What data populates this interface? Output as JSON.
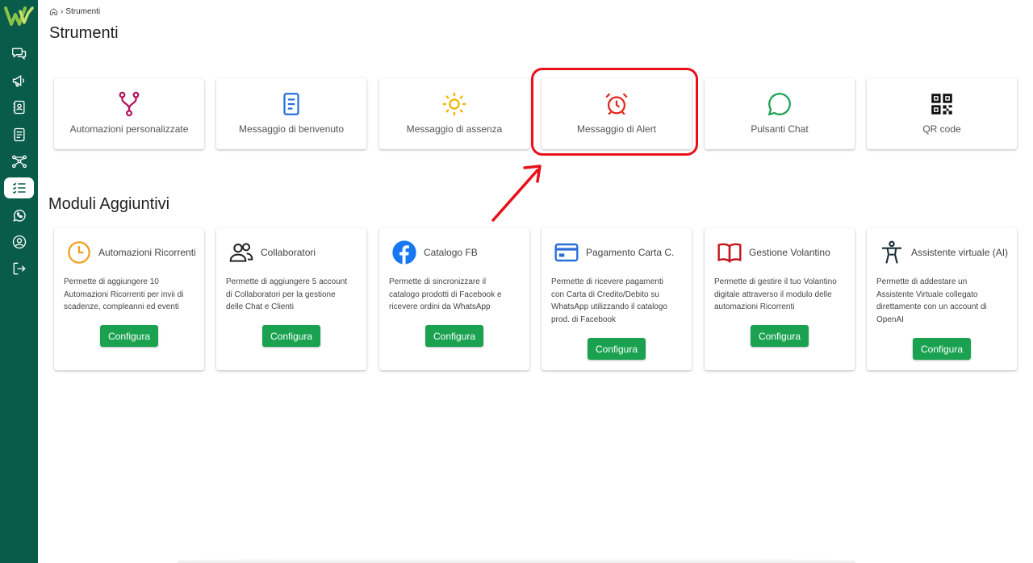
{
  "colors": {
    "sidebar": "#0a5c4a",
    "accent_green": "#1aa251",
    "highlight_red": "#e8111a"
  },
  "breadcrumb": {
    "home_icon": "home-icon",
    "current": "Strumenti"
  },
  "page_title": "Strumenti",
  "sidebar": {
    "items": [
      {
        "icon": "chat-bubbles-icon",
        "active": false
      },
      {
        "icon": "megaphone-icon",
        "active": false
      },
      {
        "icon": "contacts-book-icon",
        "active": false
      },
      {
        "icon": "document-icon",
        "active": false
      },
      {
        "icon": "flow-network-icon",
        "active": false
      },
      {
        "icon": "checklist-icon",
        "active": true
      },
      {
        "icon": "whatsapp-icon",
        "active": false
      },
      {
        "icon": "user-circle-icon",
        "active": false
      },
      {
        "icon": "logout-icon",
        "active": false
      }
    ]
  },
  "tools": [
    {
      "label": "Automazioni personalizzate",
      "icon": "branch-icon",
      "color": "#b5135e"
    },
    {
      "label": "Messaggio di benvenuto",
      "icon": "document-icon",
      "color": "#2a6fd6"
    },
    {
      "label": "Messaggio di assenza",
      "icon": "sun-icon",
      "color": "#f0b400"
    },
    {
      "label": "Messaggio di Alert",
      "icon": "alarm-clock-icon",
      "color": "#e0271d"
    },
    {
      "label": "Pulsanti Chat",
      "icon": "chat-bubble-icon",
      "color": "#1aa251"
    },
    {
      "label": "QR code",
      "icon": "qr-code-icon",
      "color": "#111111"
    }
  ],
  "modules_title": "Moduli Aggiuntivi",
  "modules": [
    {
      "title": "Automazioni Ricorrenti",
      "icon": "clock-icon",
      "color": "#f0a020",
      "desc_lines": [
        "Permette di aggiungere 10",
        "Automazioni Ricorrenti per invii di",
        "scadenze, compleanni ed eventi"
      ],
      "button": "Configura"
    },
    {
      "title": "Collaboratori",
      "icon": "users-icon",
      "color": "#222222",
      "desc_lines": [
        "Permette di aggiungere 5 account",
        "di Collaboratori per la gestione",
        "delle Chat e Clienti"
      ],
      "button": "Configura"
    },
    {
      "title": "Catalogo FB",
      "icon": "facebook-icon",
      "color": "#1877f2",
      "desc_lines": [
        "Permette di sincronizzare il",
        "catalogo prodotti di Facebook e",
        "ricevere ordini da WhatsApp"
      ],
      "button": "Configura"
    },
    {
      "title": "Pagamento Carta C.",
      "icon": "credit-card-icon",
      "color": "#2a6fd6",
      "desc_lines": [
        "Permette di ricevere pagamenti",
        "con Carta di Credito/Debito su",
        "WhatsApp utilizzando il catalogo",
        "prod. di Facebook"
      ],
      "button": "Configura"
    },
    {
      "title": "Gestione Volantino",
      "icon": "open-book-icon",
      "color": "#c0161d",
      "desc_lines": [
        "Permette di gestire il tuo Volantino",
        "digitale attraverso il modulo delle",
        "automazioni Ricorrenti"
      ],
      "button": "Configura"
    },
    {
      "title": "Assistente virtuale (AI)",
      "icon": "person-accessibility-icon",
      "color": "#1a2e3a",
      "desc_lines": [
        "Permette di addestare un",
        "Assistente Virtuale collegato",
        "direttamente con un account di",
        "OpenAI"
      ],
      "button": "Configura"
    }
  ]
}
